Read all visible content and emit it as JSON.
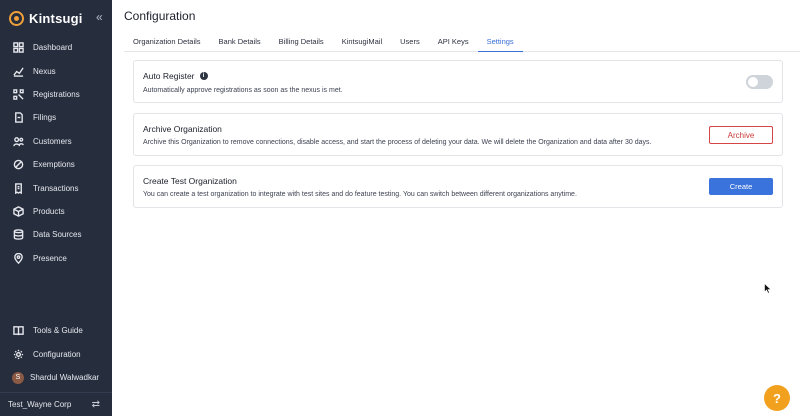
{
  "brand": {
    "name": "Kintsugi",
    "accent": "#f0a03a"
  },
  "sidebar": {
    "collapse_icon": "double-chevron-left-icon",
    "items": [
      {
        "label": "Dashboard",
        "icon": "dashboard-icon"
      },
      {
        "label": "Nexus",
        "icon": "chart-line-icon"
      },
      {
        "label": "Registrations",
        "icon": "registrations-icon"
      },
      {
        "label": "Filings",
        "icon": "file-edit-icon"
      },
      {
        "label": "Customers",
        "icon": "users-icon"
      },
      {
        "label": "Exemptions",
        "icon": "exemption-icon"
      },
      {
        "label": "Transactions",
        "icon": "receipt-icon"
      },
      {
        "label": "Products",
        "icon": "box-icon"
      },
      {
        "label": "Data Sources",
        "icon": "database-icon"
      },
      {
        "label": "Presence",
        "icon": "location-pin-icon"
      }
    ],
    "bottom_items": [
      {
        "label": "Tools & Guide",
        "icon": "book-icon"
      },
      {
        "label": "Configuration",
        "icon": "gear-icon"
      }
    ],
    "user": {
      "initial": "S",
      "name": "Shardul Walwadkar"
    },
    "org": {
      "name": "Test_Wayne Corp",
      "icon": "swap-icon"
    }
  },
  "page": {
    "title": "Configuration"
  },
  "tabs": [
    {
      "label": "Organization Details",
      "active": false
    },
    {
      "label": "Bank Details",
      "active": false
    },
    {
      "label": "Billing Details",
      "active": false
    },
    {
      "label": "KintsugiMail",
      "active": false
    },
    {
      "label": "Users",
      "active": false
    },
    {
      "label": "API Keys",
      "active": false
    },
    {
      "label": "Settings",
      "active": true
    }
  ],
  "settings": {
    "auto_register": {
      "title": "Auto Register",
      "description": "Automatically approve registrations as soon as the nexus is met.",
      "enabled": false
    },
    "archive": {
      "title": "Archive Organization",
      "description": "Archive this Organization to remove connections, disable access, and start the process of deleting your data. We will delete the Organization and data after 30 days.",
      "button_label": "Archive"
    },
    "test_org": {
      "title": "Create Test Organization",
      "description": "You can create a test organization to integrate with test sites and do feature testing. You can switch between different organizations anytime.",
      "button_label": "Create"
    }
  },
  "help_button": {
    "label": "?",
    "color": "#f2a11f"
  }
}
